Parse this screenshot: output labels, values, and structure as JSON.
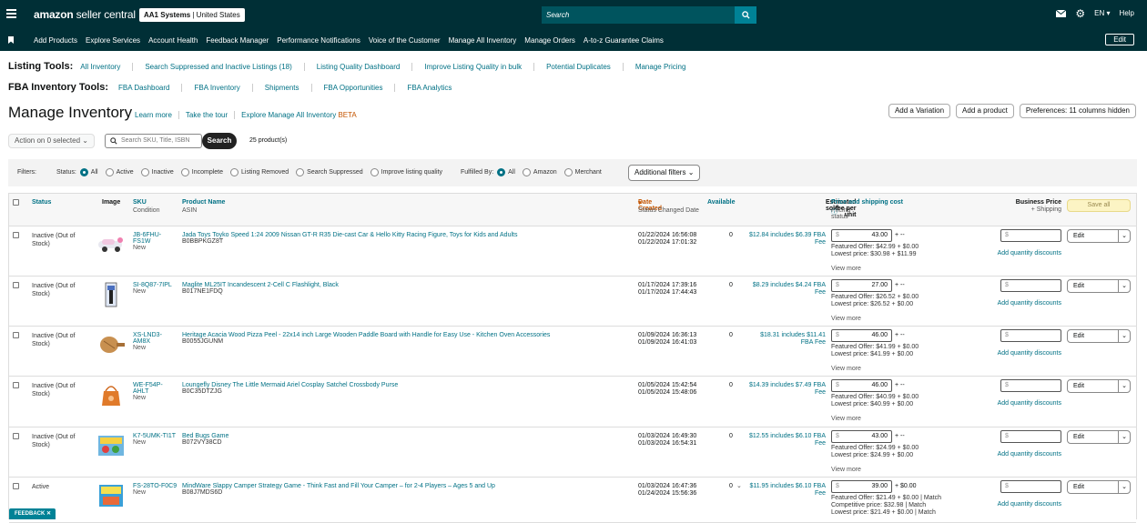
{
  "header": {
    "logo_word1": "amazon",
    "logo_word2": "seller central",
    "account_name": "AA1 Systems",
    "account_region": "| United States",
    "search_placeholder": "Search",
    "lang": "EN",
    "help": "Help"
  },
  "nav": {
    "items": [
      "Add Products",
      "Explore Services",
      "Account Health",
      "Feedback Manager",
      "Performance Notifications",
      "Voice of the Customer",
      "Manage All Inventory",
      "Manage Orders",
      "A-to-z Guarantee Claims"
    ],
    "edit": "Edit"
  },
  "listing_tools": {
    "label": "Listing Tools:",
    "links": [
      "All Inventory",
      "Search Suppressed and Inactive Listings (18)",
      "Listing Quality Dashboard",
      "Improve Listing Quality in bulk",
      "Potential Duplicates",
      "Manage Pricing"
    ]
  },
  "fba_tools": {
    "label": "FBA Inventory Tools:",
    "links": [
      "FBA Dashboard",
      "FBA Inventory",
      "Shipments",
      "FBA Opportunities",
      "FBA Analytics"
    ]
  },
  "page": {
    "title": "Manage Inventory",
    "learn_more": "Learn more",
    "tour": "Take the tour",
    "explore": "Explore Manage All Inventory",
    "beta": "BETA",
    "add_variation": "Add a Variation",
    "add_product": "Add a product",
    "preferences": "Preferences: 11 columns hidden"
  },
  "toolbar": {
    "action": "Action on 0 selected",
    "search_placeholder": "Search SKU, Title, ISBN",
    "search_button": "Search",
    "count": "25 product(s)"
  },
  "filters": {
    "label": "Filters:",
    "status_label": "Status:",
    "status_options": [
      "All",
      "Active",
      "Inactive",
      "Incomplete",
      "Listing Removed",
      "Search Suppressed",
      "Improve listing quality"
    ],
    "fulfilled_label": "Fulfilled By:",
    "fulfilled_options": [
      "All",
      "Amazon",
      "Merchant"
    ],
    "additional": "Additional filters"
  },
  "columns": {
    "status": "Status",
    "image": "Image",
    "sku": "SKU",
    "condition": "Condition",
    "product_name": "Product Name",
    "asin": "ASIN",
    "date_created": "Date Created",
    "status_changed": "Status Changed Date",
    "available": "Available",
    "fee1": "Estimated fee per unit",
    "fee2": "sold",
    "price": "Price and shipping cost",
    "pricing_status": "Pricing status",
    "business_price": "Business Price",
    "shipping": "+ Shipping",
    "save_all": "Save all"
  },
  "rows": [
    {
      "status": "Inactive (Out of Stock)",
      "sku1": "JB-6FHU-",
      "sku2": "FS1W",
      "condition": "New",
      "name": "Jada Toys Toyko Speed 1:24 2009 Nissan GT-R R35 Die-cast Car & Hello Kitty Racing Figure, Toys for Kids and Adults",
      "asin": "B0BBPKGZ8T",
      "date": "01/22/2024 16:56:08",
      "changed": "01/22/2024 17:01:32",
      "available": "0",
      "fee1": "$12.84 includes $6.39 FBA",
      "fee2": "Fee",
      "dollar": "$",
      "price": "43.00",
      "plus": "+ --",
      "line1": "Featured Offer: $42.99 + $0.00",
      "line2": "Lowest price: $30.98 + $11.99",
      "line3": "",
      "view_more": "View more",
      "qty": "Add quantity discounts",
      "edit": "Edit"
    },
    {
      "status": "Inactive (Out of Stock)",
      "sku1": "SI-8Q87-7IPL",
      "sku2": "",
      "condition": "New",
      "name": "Maglite ML25IT Incandescent 2-Cell C Flashlight, Black",
      "asin": "B017NE1FDQ",
      "date": "01/17/2024 17:39:16",
      "changed": "01/17/2024 17:44:43",
      "available": "0",
      "fee1": "$8.29 includes $4.24 FBA",
      "fee2": "Fee",
      "dollar": "$",
      "price": "27.00",
      "plus": "+ --",
      "line1": "Featured Offer: $26.52 + $0.00",
      "line2": "Lowest price: $26.52 + $0.00",
      "line3": "",
      "view_more": "View more",
      "qty": "Add quantity discounts",
      "edit": "Edit"
    },
    {
      "status": "Inactive (Out of Stock)",
      "sku1": "XS-LND3-",
      "sku2": "AM8X",
      "condition": "New",
      "name": "Heritage Acacia Wood Pizza Peel - 22x14 inch Large Wooden Paddle Board with Handle for Easy Use - Kitchen Oven Accessories",
      "asin": "B0055JGUNM",
      "date": "01/09/2024 16:36:13",
      "changed": "01/09/2024 16:41:03",
      "available": "0",
      "fee1": "$18.31 includes $11.41",
      "fee2": "FBA Fee",
      "dollar": "$",
      "price": "46.00",
      "plus": "+ --",
      "line1": "Featured Offer: $41.99 + $0.00",
      "line2": "Lowest price: $41.99 + $0.00",
      "line3": "",
      "view_more": "View more",
      "qty": "Add quantity discounts",
      "edit": "Edit"
    },
    {
      "status": "Inactive (Out of Stock)",
      "sku1": "WE-F54P-",
      "sku2": "AHLT",
      "condition": "New",
      "name": "Loungefly Disney The Little Mermaid Ariel Cosplay Satchel Crossbody Purse",
      "asin": "B0C35DTZJG",
      "date": "01/05/2024 15:42:54",
      "changed": "01/05/2024 15:48:06",
      "available": "0",
      "fee1": "$14.39 includes $7.49 FBA",
      "fee2": "Fee",
      "dollar": "$",
      "price": "46.00",
      "plus": "+ --",
      "line1": "Featured Offer: $40.99 + $0.00",
      "line2": "Lowest price: $40.99 + $0.00",
      "line3": "",
      "view_more": "View more",
      "qty": "Add quantity discounts",
      "edit": "Edit"
    },
    {
      "status": "Inactive (Out of Stock)",
      "sku1": "K7-5UMK-TI1T",
      "sku2": "",
      "condition": "New",
      "name": "Bed Bugs Game",
      "asin": "B072VY38CD",
      "date": "01/03/2024 16:49:30",
      "changed": "01/03/2024 16:54:31",
      "available": "0",
      "fee1": "$12.55 includes $6.10 FBA",
      "fee2": "Fee",
      "dollar": "$",
      "price": "43.00",
      "plus": "+ --",
      "line1": "Featured Offer: $24.99 + $0.00",
      "line2": "Lowest price: $24.99 + $0.00",
      "line3": "",
      "view_more": "View more",
      "qty": "Add quantity discounts",
      "edit": "Edit"
    },
    {
      "status": "Active",
      "sku1": "FS-28TO-F0C9",
      "sku2": "",
      "condition": "New",
      "name": "MindWare Slappy Camper Strategy Game - Think Fast and Fill Your Camper – for 2-4 Players – Ages 5 and Up",
      "asin": "B08J7MDS6D",
      "date": "01/03/2024 16:47:36",
      "changed": "01/24/2024 15:56:36",
      "available": "0",
      "fee1": "$11.95 includes $6.10 FBA",
      "fee2": "Fee",
      "dollar": "$",
      "price": "39.00",
      "plus": "+ $0.00",
      "line1": "Featured Offer: $21.49 + $0.00 | Match",
      "line2": "Competitive price: $32.98 | Match",
      "line3": "Lowest price: $21.49 + $0.00 | Match",
      "view_more": "",
      "qty": "Add quantity discounts",
      "edit": "Edit"
    }
  ],
  "feedback": "FEEDBACK"
}
